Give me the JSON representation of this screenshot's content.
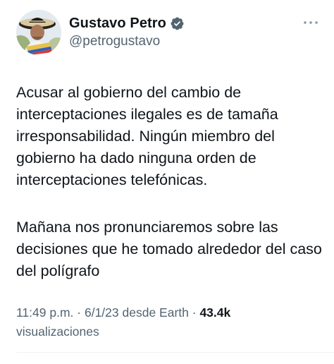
{
  "author": {
    "display_name": "Gustavo Petro",
    "handle": "@petrogustavo",
    "verified": true
  },
  "icons": {
    "verified": "verified-badge-icon",
    "more": "more-horizontal-icon"
  },
  "tweet": {
    "paragraph_1": "Acusar al gobierno del cambio de interceptaciones ilegales es de tamaña irresponsabilidad. Ningún miembro del gobierno ha dado ninguna orden de interceptaciones telefónicas.",
    "paragraph_2": "Mañana nos pronunciaremos sobre las decisiones que he tomado alrededor del caso del polígrafo"
  },
  "meta": {
    "time": "11:49 p.m.",
    "separator": "·",
    "date": "6/1/23",
    "source": "desde Earth",
    "views_count": "43.4k",
    "views_label": "visualizaciones"
  },
  "colors": {
    "text_primary": "#0f1419",
    "text_secondary": "#536471",
    "verified_badge": "#536471",
    "divider": "#eff3f4"
  }
}
